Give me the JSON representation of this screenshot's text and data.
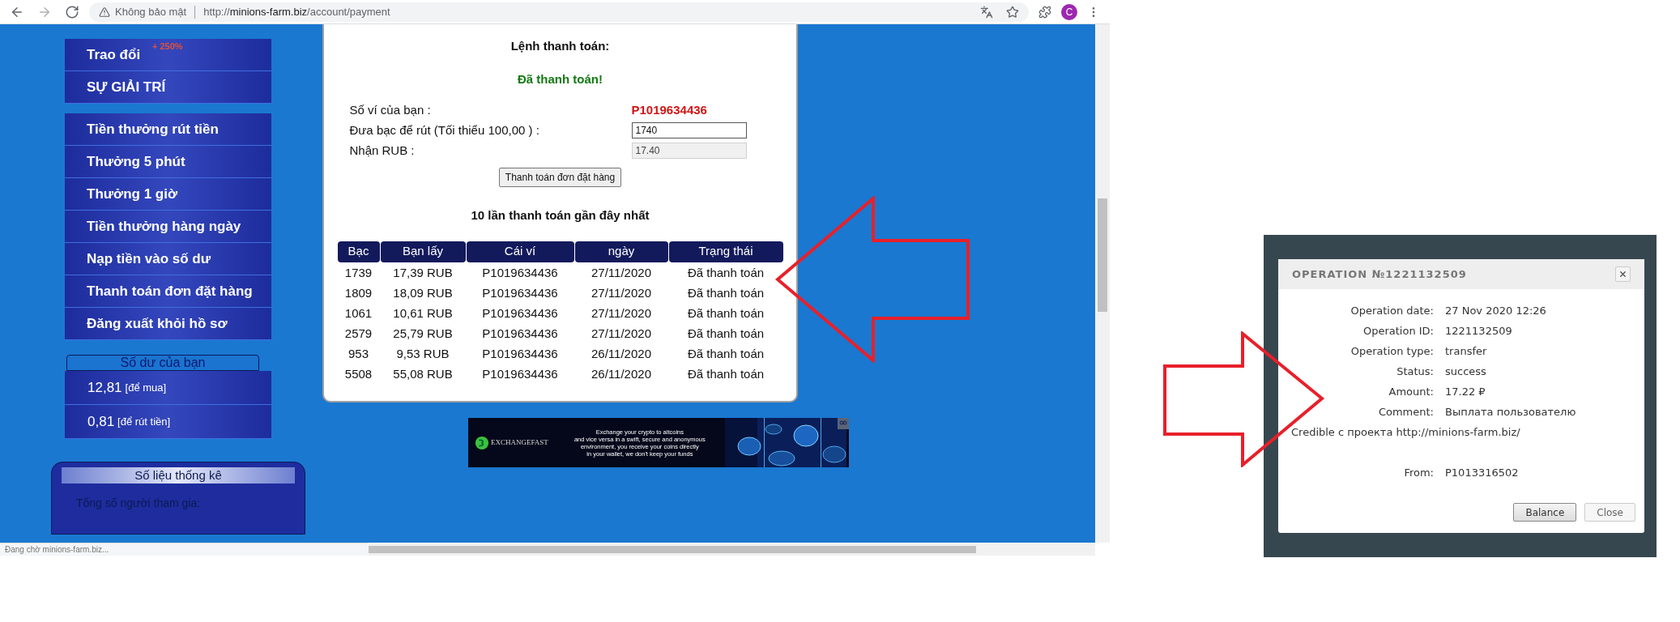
{
  "browser": {
    "nav_buttons": [
      {
        "kind": "back",
        "disabled": false
      },
      {
        "kind": "forward",
        "disabled": true
      },
      {
        "kind": "reload",
        "disabled": false
      }
    ],
    "security_label": "Không bảo mật",
    "url_scheme": "http://",
    "url_host": "minions-farm.biz",
    "url_path": "/account/payment",
    "toolbar_icons": [
      {
        "kind": "translate"
      },
      {
        "kind": "star"
      },
      {
        "kind": "extensions"
      }
    ],
    "profile_initial": "C",
    "status_text": "Đang chờ minions-farm.biz..."
  },
  "sidebar": {
    "menu_groups": [
      [
        {
          "label": "Trao đổi",
          "badge": "+ 250%"
        },
        {
          "label": "SỰ GIẢI TRÍ"
        }
      ],
      [
        {
          "label": "Tiền thưởng rút tiền"
        },
        {
          "label": "Thưởng 5 phút"
        },
        {
          "label": "Thưởng 1 giờ"
        },
        {
          "label": "Tiền thưởng hàng ngày"
        },
        {
          "label": "Nạp tiền vào số dư"
        },
        {
          "label": "Thanh toán đơn đặt hàng"
        },
        {
          "label": "Đăng xuất khỏi hồ sơ"
        }
      ]
    ],
    "balance": {
      "title": "Số dư của bạn",
      "rows": [
        {
          "amount": "12,81",
          "note": "[để mua]"
        },
        {
          "amount": "0,81",
          "note": "[để rút tiền]"
        }
      ]
    },
    "stats": {
      "title": "Số liệu thống kê",
      "lines": [
        "Tổng số người tham gia:"
      ]
    }
  },
  "payment": {
    "title": "Lệnh thanh toán:",
    "status": "Đã thanh toán!",
    "wallet": {
      "label": "Số ví của bạn :",
      "value": "P1019634436"
    },
    "fields": [
      {
        "label": "Đưa bạc để rút (Tối thiểu 100,00 ) :",
        "value": "1740",
        "readonly": false
      },
      {
        "label": "Nhận RUB :",
        "value": "17.40",
        "readonly": true
      }
    ],
    "button": "Thanh toán đơn đặt hàng",
    "history_title": "10 lần thanh toán gần đây nhất",
    "table": {
      "columns": [
        "Bạc",
        "Bạn lấy",
        "Cái ví",
        "ngày",
        "Trạng thái"
      ],
      "rows": [
        [
          "1739",
          "17,39 RUB",
          "P1019634436",
          "27/11/2020",
          "Đã thanh toán"
        ],
        [
          "1809",
          "18,09 RUB",
          "P1019634436",
          "27/11/2020",
          "Đã thanh toán"
        ],
        [
          "1061",
          "10,61 RUB",
          "P1019634436",
          "27/11/2020",
          "Đã thanh toán"
        ],
        [
          "2579",
          "25,79 RUB",
          "P1019634436",
          "27/11/2020",
          "Đã thanh toán"
        ],
        [
          "953",
          "9,53 RUB",
          "P1019634436",
          "26/11/2020",
          "Đã thanh toán"
        ],
        [
          "5508",
          "55,08 RUB",
          "P1019634436",
          "26/11/2020",
          "Đã thanh toán"
        ]
      ]
    }
  },
  "banner": {
    "brand": "EXCHANGEFAST",
    "lines": [
      "Exchange your crypto to altcoins",
      "and vice versa in a swift, secure and anonymous",
      "environment, you receive your coins directly",
      "in your wallet, we don't keep your funds"
    ]
  },
  "operation_dialog": {
    "title": "OPERATION №1221132509",
    "rows": [
      {
        "label": "Operation date:",
        "value": "27 Nov 2020 12:26"
      },
      {
        "label": "Operation ID:",
        "value": "1221132509"
      },
      {
        "label": "Operation type:",
        "value": "transfer"
      },
      {
        "label": "Status:",
        "value": "success"
      },
      {
        "label": "Amount:",
        "value": "17.22 ₽"
      },
      {
        "label": "Comment:",
        "value": "Выплата пользователю",
        "continuation": "Credible с проекта http://minions-farm.biz/"
      },
      {
        "label": "From:",
        "value": "P1013316502"
      }
    ],
    "buttons": [
      {
        "label": "Balance",
        "default": true
      },
      {
        "label": "Close",
        "default": false
      }
    ]
  }
}
